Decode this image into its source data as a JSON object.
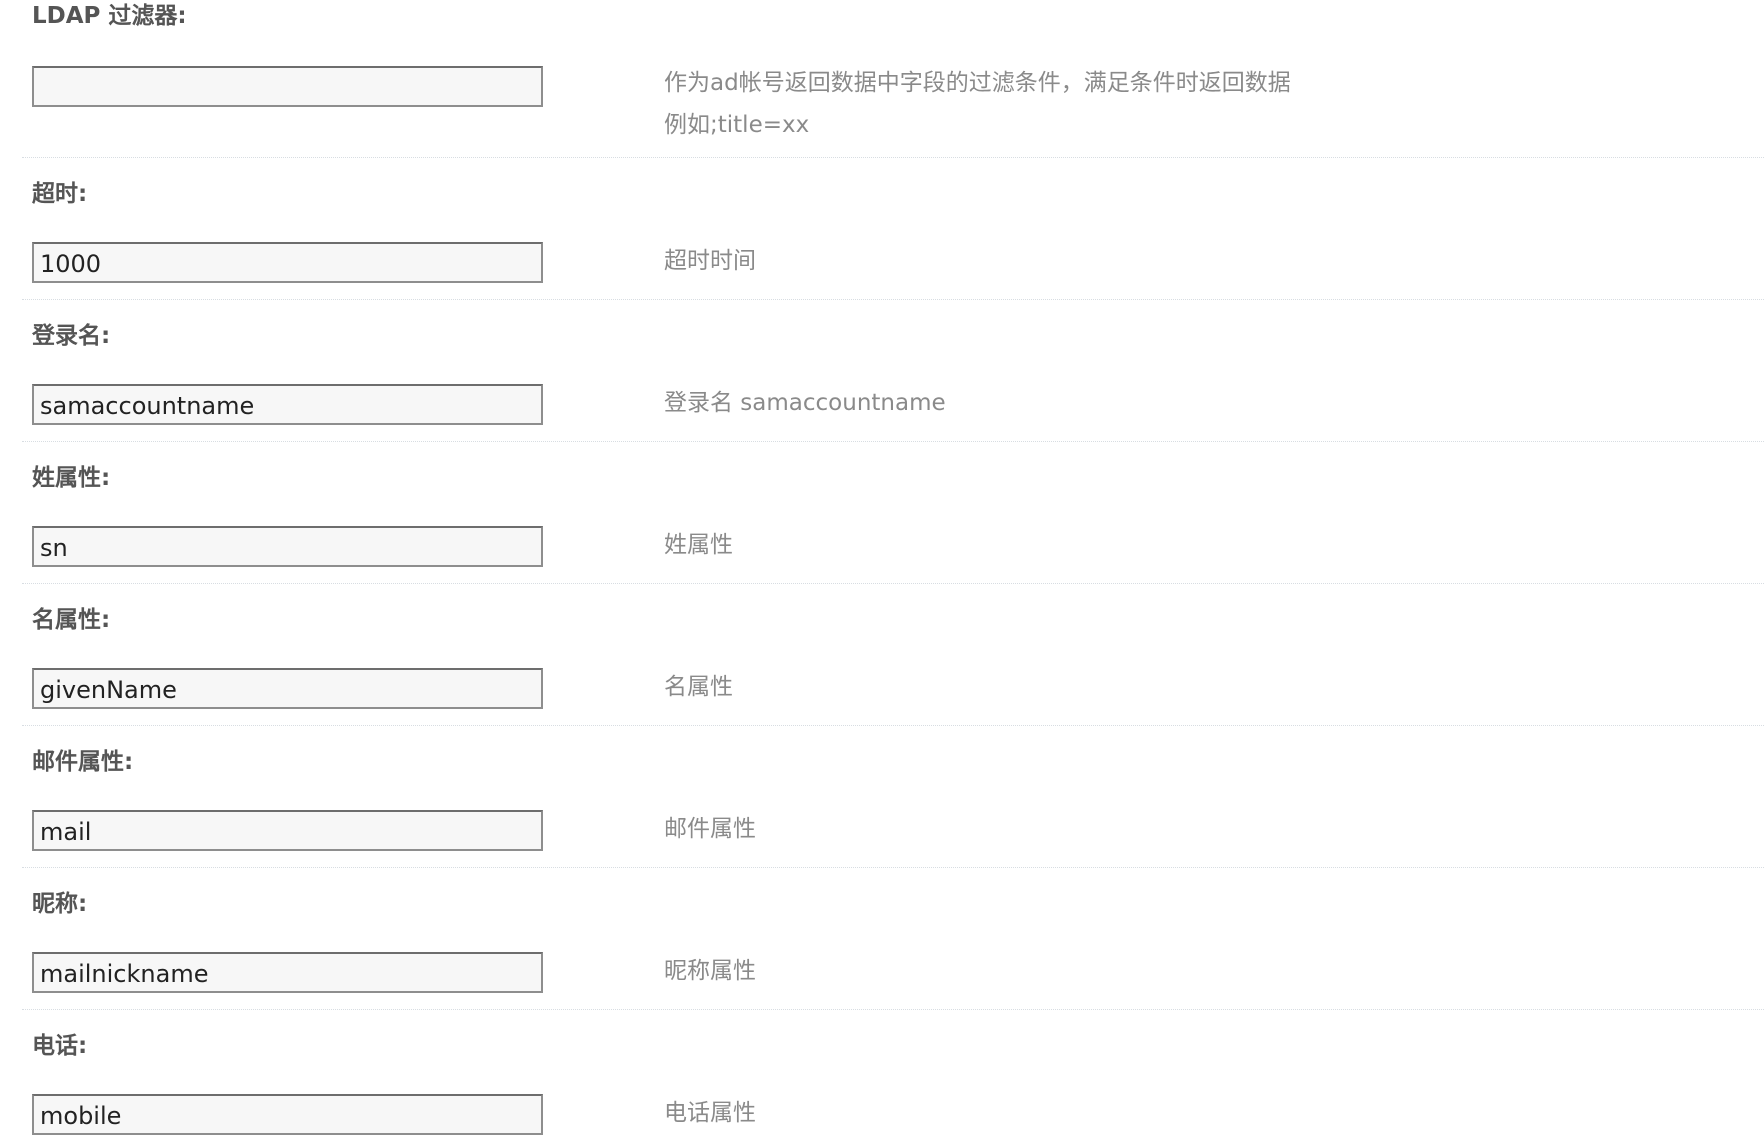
{
  "fields": [
    {
      "label": "LDAP 过滤器:",
      "value": "",
      "hint_lines": [
        "作为ad帐号返回数据中字段的过滤条件，满足条件时返回数据",
        "例如;title=xx"
      ]
    },
    {
      "label": "超时:",
      "value": "1000",
      "hint_lines": [
        "超时时间"
      ]
    },
    {
      "label": "登录名:",
      "value": "samaccountname",
      "hint_lines": [
        "登录名 samaccountname"
      ]
    },
    {
      "label": "姓属性:",
      "value": "sn",
      "hint_lines": [
        "姓属性"
      ]
    },
    {
      "label": "名属性:",
      "value": "givenName",
      "hint_lines": [
        "名属性"
      ]
    },
    {
      "label": "邮件属性:",
      "value": "mail",
      "hint_lines": [
        "邮件属性"
      ]
    },
    {
      "label": "昵称:",
      "value": "mailnickname",
      "hint_lines": [
        "昵称属性"
      ]
    },
    {
      "label": "电话:",
      "value": "mobile",
      "hint_lines": [
        "电话属性"
      ]
    }
  ]
}
